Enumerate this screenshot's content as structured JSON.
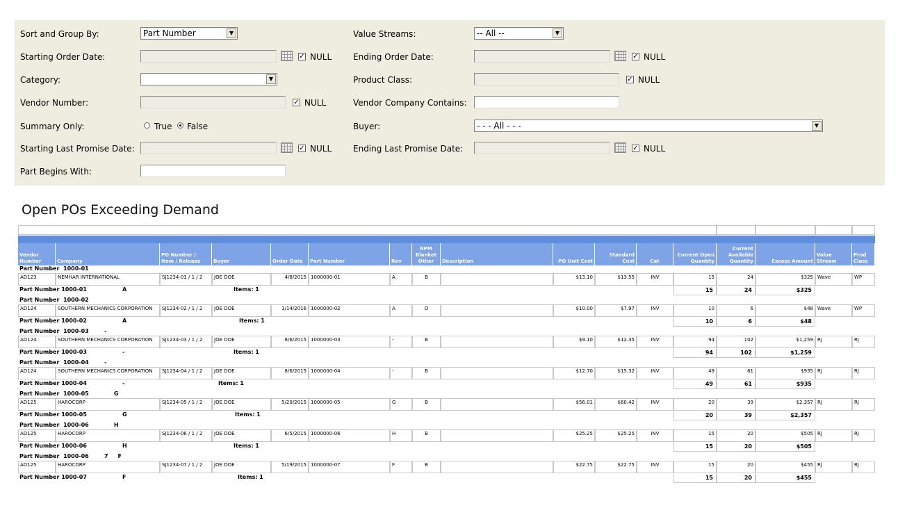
{
  "filters": {
    "sort_group_label": "Sort and Group By:",
    "sort_group_value": "Part Number",
    "value_streams_label": "Value Streams:",
    "value_streams_value": "-- All --",
    "start_order_label": "Starting Order Date:",
    "end_order_label": "Ending Order Date:",
    "category_label": "Category:",
    "category_value": "",
    "product_class_label": "Product Class:",
    "vendor_number_label": "Vendor Number:",
    "vendor_company_label": "Vendor Company Contains:",
    "summary_label": "Summary Only:",
    "summary_true": "True",
    "summary_false": "False",
    "summary_selected": "False",
    "buyer_label": "Buyer:",
    "buyer_value": "- - - All - - -",
    "start_promise_label": "Starting Last Promise Date:",
    "end_promise_label": "Ending Last Promise Date:",
    "part_begins_label": "Part Begins With:",
    "null_label": "NULL",
    "check_mark": "✓"
  },
  "report": {
    "title": "Open POs Exceeding Demand",
    "columns": [
      "Vendor Number",
      "Company",
      "PO Number / Item / Release",
      "Buyer",
      "Order Date",
      "Part Number",
      "Rev",
      "RPM Blanket Other",
      "Description",
      "PO Unit Cost",
      "Standard Cost",
      "Cat",
      "Current Open Quantity",
      "Current Available Quantity",
      "Excess Amount",
      "Value Stream",
      "Prod Class"
    ],
    "groups": [
      {
        "heading": "Part Number  1000-01",
        "row": [
          "AD123",
          "NEMHAR INTERNATIONAL",
          "SJ1234-01 /  1 /  2",
          "JOE DOE",
          "4/8/2015",
          "1000000-01",
          "A",
          "B",
          "",
          "$13.10",
          "$13.55",
          "INV",
          "15",
          "24",
          "$325",
          "Wave",
          "WP"
        ],
        "footer_part": "Part Number 1000-01",
        "footer_rev": "A",
        "footer_items": "Items: 1",
        "sum_open": "15",
        "sum_avail": "24",
        "sum_excess": "$325"
      },
      {
        "heading": "Part Number  1000-02",
        "row": [
          "AD124",
          "SOUTHERN MECHANICS CORPORATION",
          "SJ1234-02 /  1 /  2",
          "JOE DOE",
          "1/14/2016",
          "1000000-02",
          "A",
          "O",
          "",
          "$10.00",
          "$7.97",
          "INV",
          "10",
          "6",
          "$48",
          "Wave",
          "WP"
        ],
        "footer_part": "Part Number 1000-02",
        "footer_rev": "A",
        "footer_items": "Items: 1",
        "sum_open": "10",
        "sum_avail": "6",
        "sum_excess": "$48"
      },
      {
        "heading": "Part Number  1000-03        -",
        "row": [
          "AD124",
          "SOUTHERN MECHANICS CORPORATION",
          "SJ1234-03 /  1 /  2",
          "JOE DOE",
          "8/6/2015",
          "1000000-03",
          "-",
          "B",
          "",
          "$9.10",
          "$12.35",
          "INV",
          "94",
          "102",
          "$1,259",
          "RJ",
          "RJ"
        ],
        "footer_part": "Part Number 1000-03",
        "footer_rev": "-",
        "footer_items": "Items: 1",
        "sum_open": "94",
        "sum_avail": "102",
        "sum_excess": "$1,259"
      },
      {
        "heading": "Part Number  1000-04        -",
        "row": [
          "AD124",
          "SOUTHERN MECHANICS CORPORATION",
          "SJ1234-04 /  1 /  2",
          "JOE DOE",
          "8/6/2015",
          "1000000-04",
          "-",
          "B",
          "",
          "$12.70",
          "$15.32",
          "INV",
          "49",
          "61",
          "$935",
          "RJ",
          "RJ"
        ],
        "footer_part": "Part Number 1000-04",
        "footer_rev": "-",
        "footer_items": "Items: 1",
        "sum_open": "49",
        "sum_avail": "61",
        "sum_excess": "$935"
      },
      {
        "heading": "Part Number  1000-05             G",
        "row": [
          "AD125",
          "HAROCORP",
          "SJ1234-05 /  1 /  2",
          "JOE DOE",
          "5/20/2015",
          "1000000-05",
          "G",
          "B",
          "",
          "$56.01",
          "$60.42",
          "INV",
          "20",
          "39",
          "$2,357",
          "RJ",
          "RJ"
        ],
        "footer_part": "Part Number 1000-05",
        "footer_rev": "G",
        "footer_items": "Items: 1",
        "sum_open": "20",
        "sum_avail": "39",
        "sum_excess": "$2,357"
      },
      {
        "heading": "Part Number  1000-06             H",
        "row": [
          "AD125",
          "HAROCORP",
          "SJ1234-06 /  1 /  2",
          "JOE DOE",
          "6/5/2015",
          "1000000-06",
          "H",
          "B",
          "",
          "$25.25",
          "$25.25",
          "INV",
          "15",
          "20",
          "$505",
          "RJ",
          "RJ"
        ],
        "footer_part": "Part Number 1000-06",
        "footer_rev": "H",
        "footer_items": "Items: 1",
        "sum_open": "15",
        "sum_avail": "20",
        "sum_excess": "$505"
      },
      {
        "heading": "Part Number  1000-06        7     F",
        "row": [
          "AD125",
          "HAROCORP",
          "SJ1234-07 /  1 /  2",
          "JOE DOE",
          "5/19/2015",
          "1000000-07",
          "F",
          "B",
          "",
          "$22.75",
          "$22.75",
          "INV",
          "15",
          "20",
          "$455",
          "RJ",
          "RJ"
        ],
        "footer_part": "Part Number 1000-07",
        "footer_rev": "F",
        "footer_items": "Items: 1",
        "sum_open": "15",
        "sum_avail": "20",
        "sum_excess": "$455"
      }
    ]
  }
}
